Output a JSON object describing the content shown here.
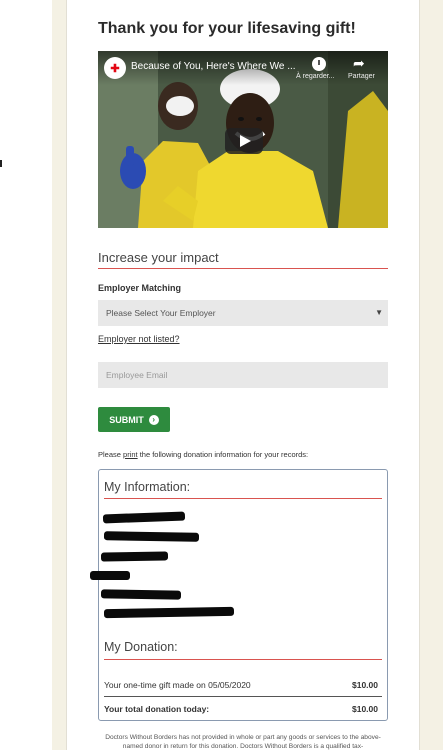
{
  "page": {
    "title": "Thank you for your lifesaving gift!"
  },
  "video": {
    "channel_logo": "msf-logo-icon",
    "logo_glyph": "✚",
    "title": "Because of You, Here's Where We ...",
    "watch_later_label": "À regarder...",
    "share_label": "Partager",
    "share_glyph": "➦"
  },
  "impact": {
    "heading": "Increase your impact",
    "employer_label": "Employer Matching",
    "employer_select_value": "Please Select Your Employer",
    "select_caret": "▼",
    "not_listed_link": "Employer not listed?",
    "email_placeholder": "Employee Email",
    "submit_label": "SUBMIT",
    "submit_arrow": "›"
  },
  "records": {
    "note_before": "Please ",
    "note_link": "print",
    "note_after": " the following donation information for your records:"
  },
  "my_information": {
    "heading": "My Information:"
  },
  "my_donation": {
    "heading": "My Donation:",
    "gift_label": "Your one-time gift made on 05/05/2020",
    "gift_amount": "$10.00",
    "total_label": "Your total donation today:",
    "total_amount": "$10.00"
  },
  "disclaimer": "Doctors Without Borders has not provided in whole or part any goods or services to the above-named donor in return for this donation. Doctors Without Borders is a qualified tax-",
  "colors": {
    "accent_red": "#d9534f",
    "submit_green": "#2e8b3e",
    "gutter": "#f4f1e4"
  }
}
